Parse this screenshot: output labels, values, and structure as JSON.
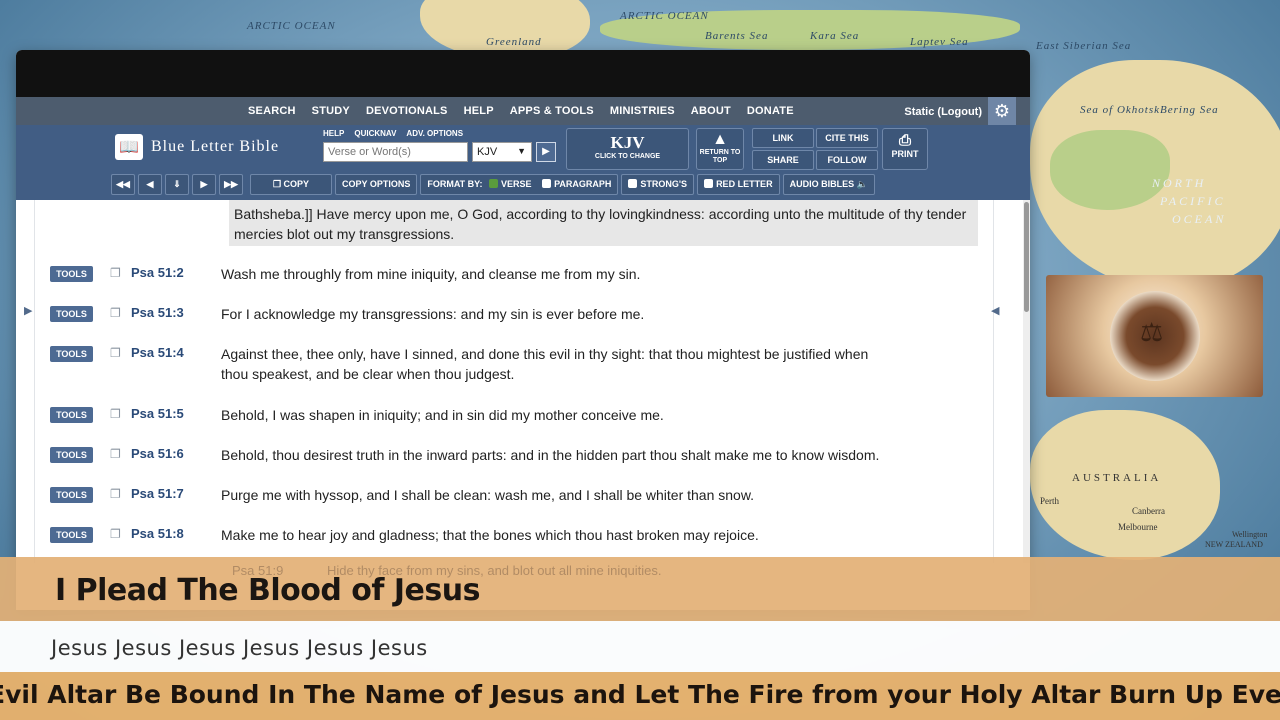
{
  "map": {
    "labels": [
      "ARCTIC OCEAN",
      "ARCTIC OCEAN",
      "Greenland",
      "Barents Sea",
      "Kara Sea",
      "Laptev Sea",
      "East Siberian Sea",
      "Sea of Okhotsk",
      "Bering Sea",
      "NORTH",
      "PACIFIC",
      "OCEAN",
      "AUSTRALIA",
      "Canberra",
      "Perth",
      "Melbourne",
      "NEW ZEALAND",
      "Wellington"
    ]
  },
  "nav": {
    "links": [
      "SEARCH",
      "STUDY",
      "DEVOTIONALS",
      "HELP",
      "APPS & TOOLS",
      "MINISTRIES",
      "ABOUT",
      "DONATE"
    ],
    "user": "Static (Logout)"
  },
  "blb": {
    "logo": "Blue Letter Bible",
    "sublinks": [
      "HELP",
      "QUICKNAV",
      "ADV. OPTIONS"
    ],
    "search_placeholder": "Verse or Word(s)",
    "version_value": "KJV",
    "kjv_big": "KJV",
    "kjv_small": "CLICK TO CHANGE",
    "return_top": "RETURN TO TOP",
    "link": "LINK",
    "cite_this": "CITE THIS",
    "share": "SHARE",
    "follow": "FOLLOW",
    "print": "PRINT",
    "copy": "COPY",
    "copy_options": "COPY OPTIONS",
    "format_by": "FORMAT BY:",
    "verse": "VERSE",
    "paragraph": "PARAGRAPH",
    "strongs": "STRONG'S",
    "red_letter": "RED LETTER",
    "audio_bibles": "AUDIO BIBLES"
  },
  "passage": {
    "first_text": "Bathsheba.]] Have mercy upon me, O God, according to thy lovingkindness: according unto the multitude of thy tender mercies blot out my transgressions.",
    "tools_label": "TOOLS",
    "verses": [
      {
        "ref": "Psa 51:2",
        "text": "Wash me throughly from mine iniquity, and cleanse me from my sin."
      },
      {
        "ref": "Psa 51:3",
        "text": "For I acknowledge my transgressions: and my sin is ever before me."
      },
      {
        "ref": "Psa 51:4",
        "text": "Against thee, thee only, have I sinned, and done this evil in thy sight: that thou mightest be justified when thou speakest, and be clear when thou judgest."
      },
      {
        "ref": "Psa 51:5",
        "text": "Behold, I was shapen in iniquity; and in sin did my mother conceive me."
      },
      {
        "ref": "Psa 51:6",
        "text": "Behold, thou desirest truth in the inward parts: and in the hidden part thou shalt make me to know wisdom."
      },
      {
        "ref": "Psa 51:7",
        "text": "Purge me with hyssop, and I shall be clean: wash me, and I shall be whiter than snow."
      },
      {
        "ref": "Psa 51:8",
        "text": "Make me to hear joy and gladness; that the bones which thou hast broken may rejoice."
      }
    ],
    "partial_ref": "Psa 51:9",
    "partial_text": "Hide thy face from my sins, and blot out all mine iniquities."
  },
  "overlay": {
    "title": "I Plead The Blood of Jesus",
    "subtitle": "Jesus Jesus Jesus Jesus Jesus Jesus",
    "ticker": "Evil Altar Be Bound In The Name of Jesus and Let The Fire from your Holy Altar Burn Up Every Evil Altar"
  }
}
